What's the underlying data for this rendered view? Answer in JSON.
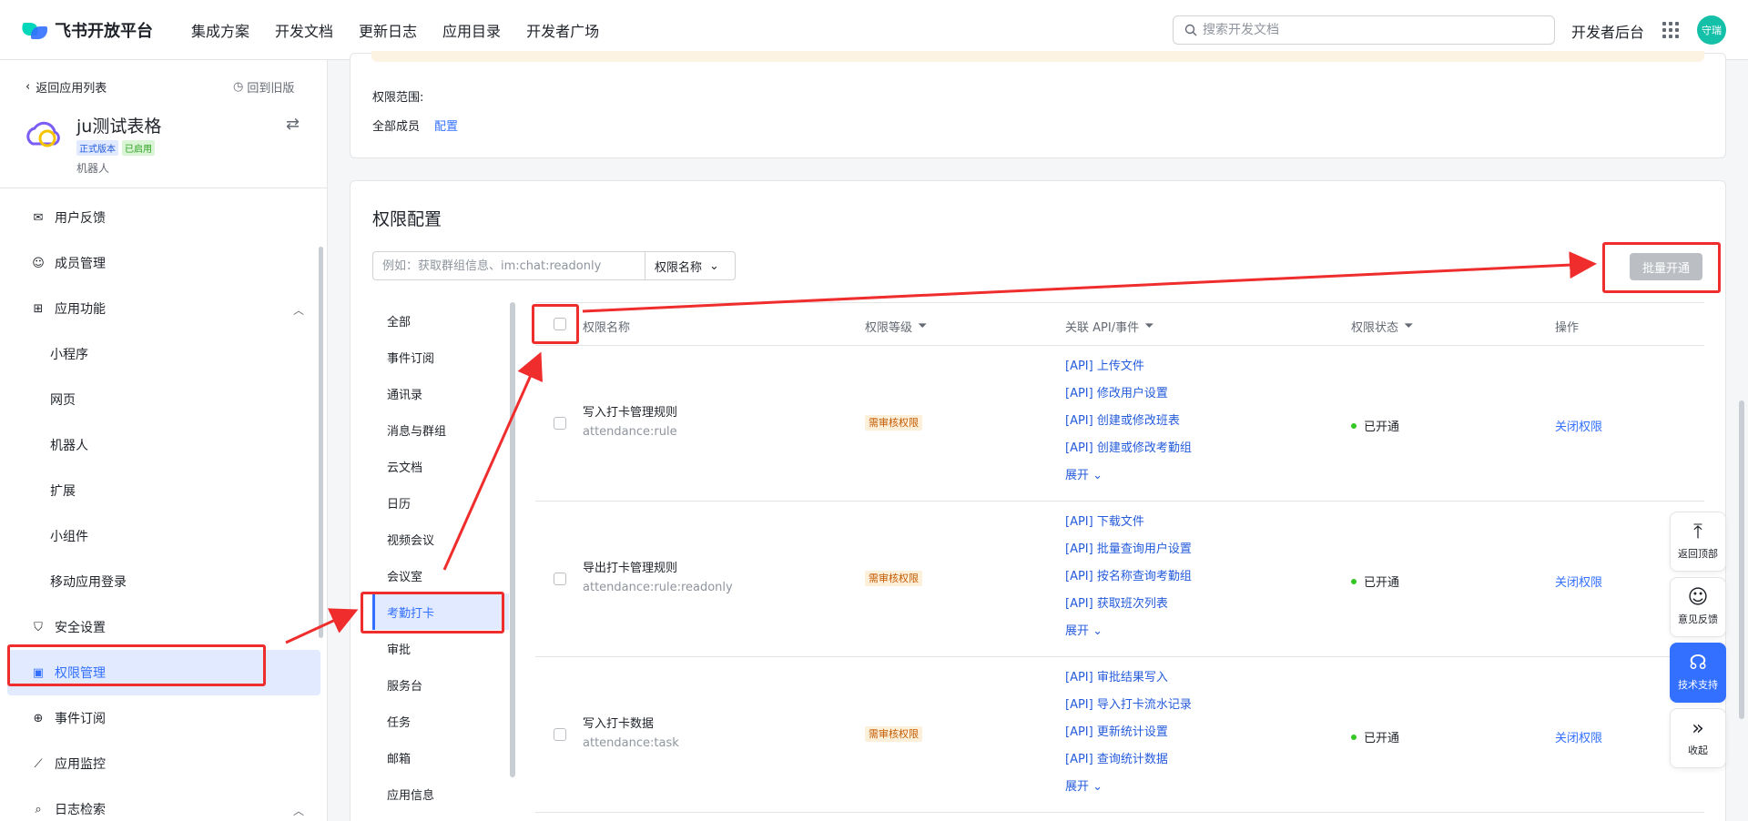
{
  "header": {
    "logo_text": "飞书开放平台",
    "nav": [
      "集成方案",
      "开发文档",
      "更新日志",
      "应用目录",
      "开发者广场"
    ],
    "search_placeholder": "搜索开发文档",
    "dev_console": "开发者后台",
    "avatar_text": "守瑞"
  },
  "sidebar": {
    "back_label": "返回应用列表",
    "old_version_label": "回到旧版",
    "app_name": "ju测试表格",
    "badge_release": "正式版本",
    "badge_enabled": "已启用",
    "app_type": "机器人",
    "items": [
      {
        "label": "用户反馈",
        "icon": "inbox-icon"
      },
      {
        "label": "成员管理",
        "icon": "user-icon"
      },
      {
        "label": "应用功能",
        "icon": "apps-grid-icon"
      },
      {
        "label": "小程序"
      },
      {
        "label": "网页"
      },
      {
        "label": "机器人"
      },
      {
        "label": "扩展"
      },
      {
        "label": "小组件"
      },
      {
        "label": "移动应用登录"
      },
      {
        "label": "安全设置",
        "icon": "shield-icon"
      },
      {
        "label": "权限管理",
        "icon": "briefcase-icon"
      },
      {
        "label": "事件订阅",
        "icon": "event-plus-icon"
      },
      {
        "label": "应用监控",
        "icon": "chart-line-icon"
      },
      {
        "label": "日志检索",
        "icon": "log-search-icon"
      }
    ]
  },
  "scope": {
    "label": "权限范围:",
    "value": "全部成员",
    "config": "配置"
  },
  "permissions": {
    "title": "权限配置",
    "filter_placeholder": "例如：获取群组信息、im:chat:readonly",
    "filter_select": "权限名称",
    "batch_button": "批量开通",
    "categories": [
      "全部",
      "事件订阅",
      "通讯录",
      "消息与群组",
      "云文档",
      "日历",
      "视频会议",
      "会议室",
      "考勤打卡",
      "审批",
      "服务台",
      "任务",
      "邮箱",
      "应用信息"
    ],
    "columns": [
      "权限名称",
      "权限等级",
      "关联 API/事件",
      "权限状态",
      "操作"
    ],
    "rows": [
      {
        "name": "写入打卡管理规则",
        "code": "attendance:rule",
        "level": "需审核权限",
        "apis": [
          "[API] 上传文件",
          "[API] 修改用户设置",
          "[API] 创建或修改班表",
          "[API] 创建或修改考勤组"
        ],
        "expand": "展开",
        "status": "已开通",
        "action": "关闭权限"
      },
      {
        "name": "导出打卡管理规则",
        "code": "attendance:rule:readonly",
        "level": "需审核权限",
        "apis": [
          "[API] 下载文件",
          "[API] 批量查询用户设置",
          "[API] 按名称查询考勤组",
          "[API] 获取班次列表"
        ],
        "expand": "展开",
        "status": "已开通",
        "action": "关闭权限"
      },
      {
        "name": "写入打卡数据",
        "code": "attendance:task",
        "level": "需审核权限",
        "apis": [
          "[API] 审批结果写入",
          "[API] 导入打卡流水记录",
          "[API] 更新统计设置",
          "[API] 查询统计数据"
        ],
        "expand": "展开",
        "status": "已开通",
        "action": "关闭权限"
      }
    ]
  },
  "float_tools": {
    "back_top": "返回顶部",
    "feedback": "意见反馈",
    "support": "技术支持",
    "collapse": "收起"
  },
  "colors": {
    "accent": "#3370ff",
    "annotation_red": "#f02d2d",
    "status_green": "#34c724"
  }
}
